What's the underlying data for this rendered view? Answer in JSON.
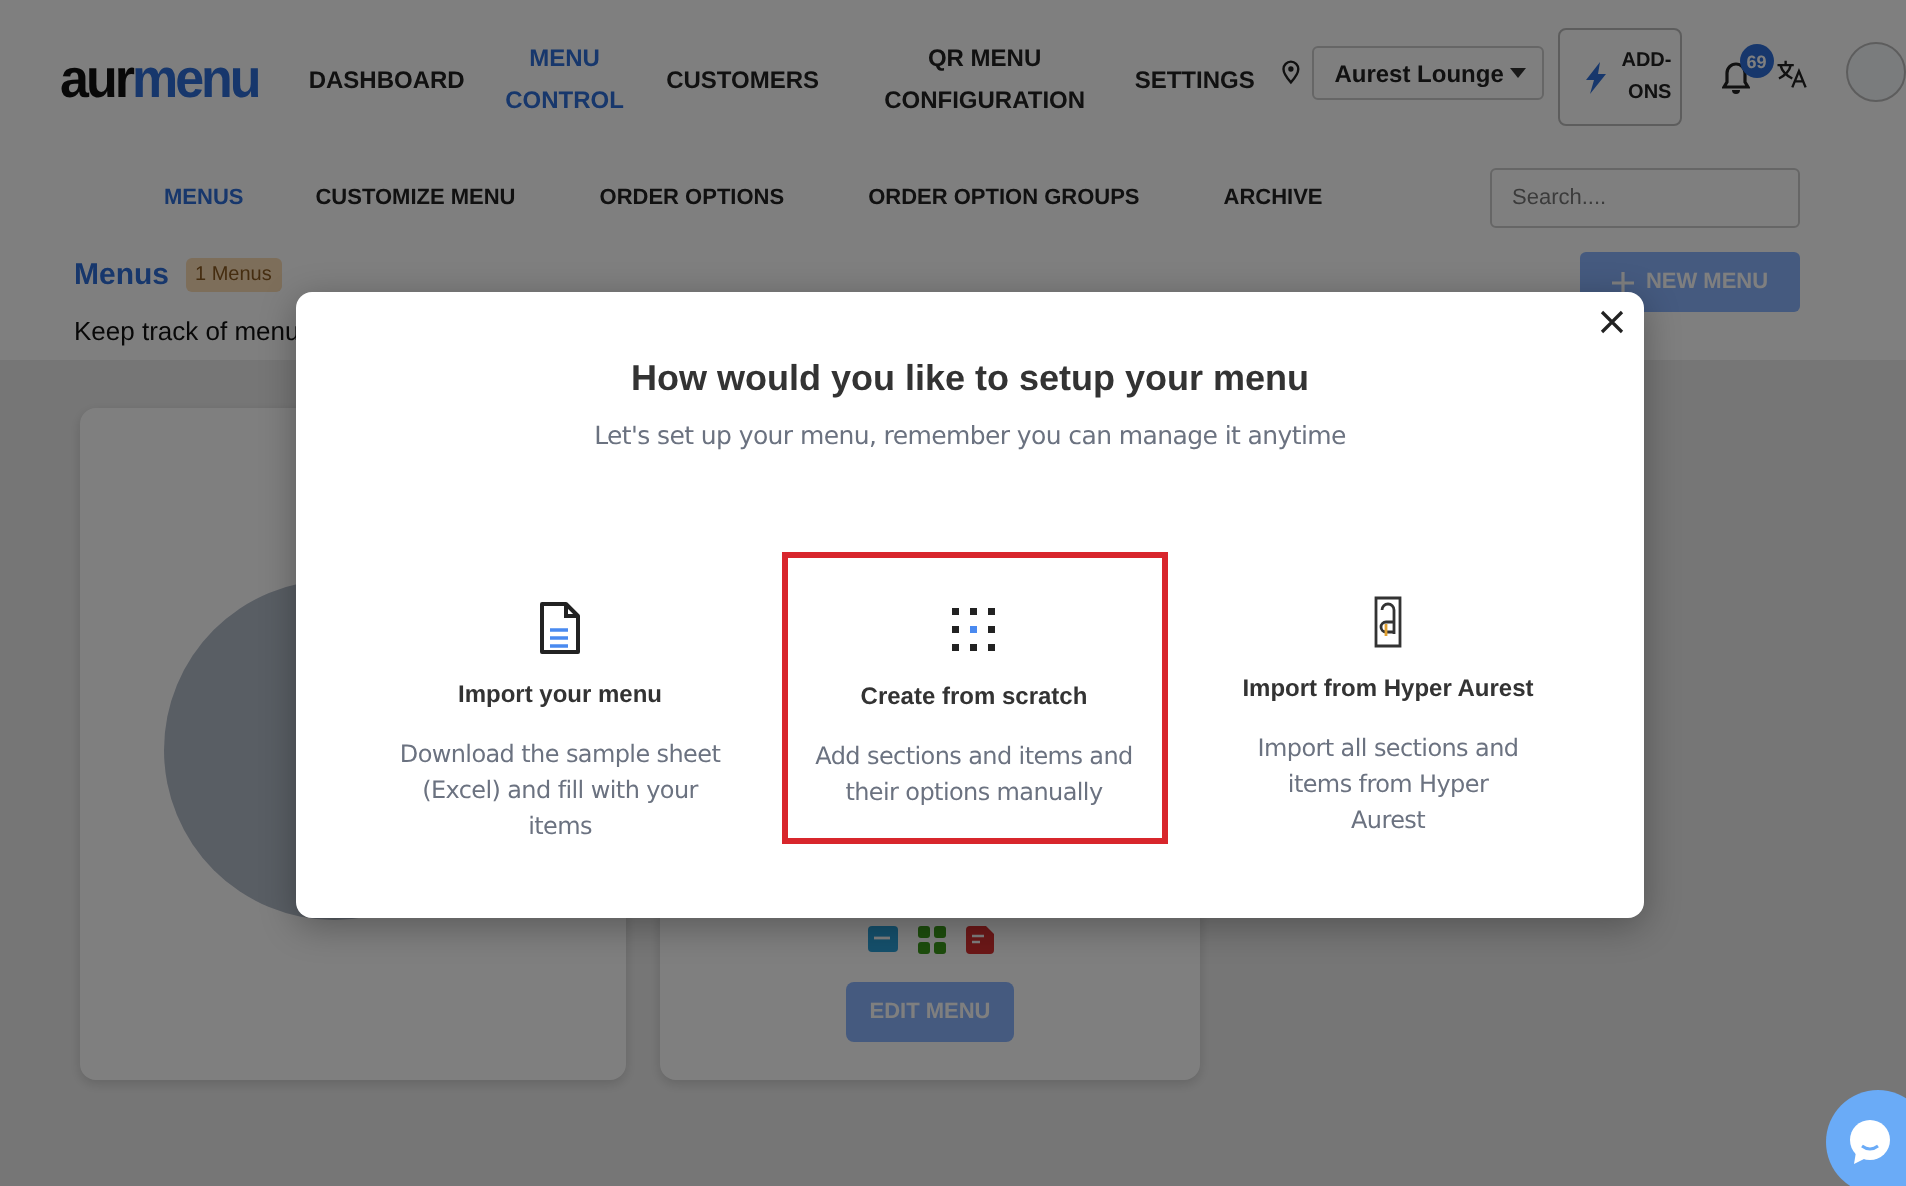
{
  "logo": {
    "dark_part": "aur",
    "blue_part": "menu"
  },
  "nav": [
    {
      "label": "DASHBOARD",
      "selected": false
    },
    {
      "label": "MENU CONTROL",
      "selected": true
    },
    {
      "label": "CUSTOMERS",
      "selected": false
    },
    {
      "label": "QR MENU CONFIGURATION",
      "selected": false
    },
    {
      "label": "SETTINGS",
      "selected": false
    }
  ],
  "branch_select": {
    "value": "Aurest Lounge"
  },
  "addons_button": "ADD-ONS",
  "notifications": {
    "count": "69"
  },
  "subnav": [
    {
      "label": "MENUS",
      "selected": true
    },
    {
      "label": "CUSTOMIZE MENU",
      "selected": false
    },
    {
      "label": "ORDER OPTIONS",
      "selected": false
    },
    {
      "label": "ORDER OPTION GROUPS",
      "selected": false
    },
    {
      "label": "ARCHIVE",
      "selected": false
    }
  ],
  "search": {
    "placeholder": "Search...."
  },
  "page": {
    "title": "Menus",
    "badge": "1 Menus",
    "subtitle": "Keep track of menu",
    "new_button": "NEW MENU"
  },
  "menu_card": {
    "button": "EDIT MENU"
  },
  "modal": {
    "title": "How would you like to setup your menu",
    "subtitle": "Let's set up your menu, remember you can manage it anytime",
    "options": [
      {
        "kind": "file",
        "title": "Import your menu",
        "description": "Download the sample sheet (Excel) and fill with your items",
        "selected": false
      },
      {
        "kind": "grid",
        "title": "Create from scratch",
        "description": "Add sections and items and their options manually",
        "selected": true
      },
      {
        "kind": "app",
        "title": "Import from Hyper Aurest",
        "description": "Import all sections and items from Hyper Aurest",
        "selected": false
      }
    ]
  }
}
